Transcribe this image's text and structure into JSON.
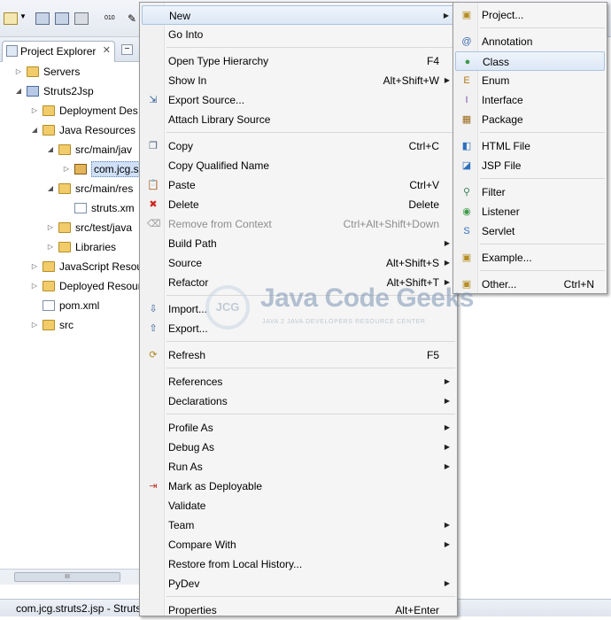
{
  "explorer": {
    "tab_label": "Project Explorer",
    "tree": [
      {
        "label": "Servers",
        "indent": 0,
        "twisty": "▷",
        "icon": "fold"
      },
      {
        "label": "Struts2Jsp",
        "indent": 0,
        "twisty": "◢",
        "icon": "proj"
      },
      {
        "label": "Deployment Des",
        "indent": 1,
        "twisty": "▷",
        "icon": "fold"
      },
      {
        "label": "Java Resources",
        "indent": 1,
        "twisty": "◢",
        "icon": "fold"
      },
      {
        "label": "src/main/jav",
        "indent": 2,
        "twisty": "◢",
        "icon": "fold"
      },
      {
        "label": "com.jcg.s",
        "indent": 3,
        "twisty": "▷",
        "icon": "pkg",
        "selected": true
      },
      {
        "label": "src/main/res",
        "indent": 2,
        "twisty": "◢",
        "icon": "fold"
      },
      {
        "label": "struts.xm",
        "indent": 3,
        "twisty": "",
        "icon": "filex"
      },
      {
        "label": "src/test/java",
        "indent": 2,
        "twisty": "▷",
        "icon": "fold"
      },
      {
        "label": "Libraries",
        "indent": 2,
        "twisty": "▷",
        "icon": "fold"
      },
      {
        "label": "JavaScript Resou",
        "indent": 1,
        "twisty": "▷",
        "icon": "fold"
      },
      {
        "label": "Deployed Resour",
        "indent": 1,
        "twisty": "▷",
        "icon": "fold"
      },
      {
        "label": "pom.xml",
        "indent": 1,
        "twisty": "",
        "icon": "filex"
      },
      {
        "label": "src",
        "indent": 1,
        "twisty": "▷",
        "icon": "fold"
      }
    ]
  },
  "status": {
    "text": "com.jcg.struts2.jsp - Struts"
  },
  "context_menu": {
    "items": [
      {
        "label": "New",
        "shortcut": "",
        "submenu": true,
        "highlighted": true,
        "icon": ""
      },
      {
        "label": "Go Into",
        "shortcut": "",
        "icon": ""
      },
      {
        "separator": true
      },
      {
        "label": "Open Type Hierarchy",
        "shortcut": "F4",
        "icon": ""
      },
      {
        "label": "Show In",
        "shortcut": "Alt+Shift+W",
        "submenu": true,
        "icon": ""
      },
      {
        "label": "Export Source...",
        "shortcut": "",
        "icon": "export-source-icon"
      },
      {
        "label": "Attach Library Source",
        "shortcut": "",
        "icon": ""
      },
      {
        "separator": true
      },
      {
        "label": "Copy",
        "shortcut": "Ctrl+C",
        "icon": "copy-icon"
      },
      {
        "label": "Copy Qualified Name",
        "shortcut": "",
        "icon": ""
      },
      {
        "label": "Paste",
        "shortcut": "Ctrl+V",
        "icon": "paste-icon"
      },
      {
        "label": "Delete",
        "shortcut": "Delete",
        "icon": "delete-icon"
      },
      {
        "label": "Remove from Context",
        "shortcut": "Ctrl+Alt+Shift+Down",
        "disabled": true,
        "icon": "remove-context-icon"
      },
      {
        "label": "Build Path",
        "shortcut": "",
        "submenu": true,
        "icon": ""
      },
      {
        "label": "Source",
        "shortcut": "Alt+Shift+S",
        "submenu": true,
        "icon": ""
      },
      {
        "label": "Refactor",
        "shortcut": "Alt+Shift+T",
        "submenu": true,
        "icon": ""
      },
      {
        "separator": true
      },
      {
        "label": "Import...",
        "shortcut": "",
        "icon": "import-icon"
      },
      {
        "label": "Export...",
        "shortcut": "",
        "icon": "export-icon"
      },
      {
        "separator": true
      },
      {
        "label": "Refresh",
        "shortcut": "F5",
        "icon": "refresh-icon"
      },
      {
        "separator": true
      },
      {
        "label": "References",
        "shortcut": "",
        "submenu": true,
        "icon": ""
      },
      {
        "label": "Declarations",
        "shortcut": "",
        "submenu": true,
        "icon": ""
      },
      {
        "separator": true
      },
      {
        "label": "Profile As",
        "shortcut": "",
        "submenu": true,
        "icon": ""
      },
      {
        "label": "Debug As",
        "shortcut": "",
        "submenu": true,
        "icon": ""
      },
      {
        "label": "Run As",
        "shortcut": "",
        "submenu": true,
        "icon": ""
      },
      {
        "label": "Mark as Deployable",
        "shortcut": "",
        "icon": "deployable-icon"
      },
      {
        "label": "Validate",
        "shortcut": "",
        "icon": ""
      },
      {
        "label": "Team",
        "shortcut": "",
        "submenu": true,
        "icon": ""
      },
      {
        "label": "Compare With",
        "shortcut": "",
        "submenu": true,
        "icon": ""
      },
      {
        "label": "Restore from Local History...",
        "shortcut": "",
        "icon": ""
      },
      {
        "label": "PyDev",
        "shortcut": "",
        "submenu": true,
        "icon": ""
      },
      {
        "separator": true
      },
      {
        "label": "Properties",
        "shortcut": "Alt+Enter",
        "icon": ""
      }
    ]
  },
  "submenu_new": {
    "items": [
      {
        "label": "Project...",
        "shortcut": "",
        "icon": "new-project-icon"
      },
      {
        "separator": true
      },
      {
        "label": "Annotation",
        "shortcut": "",
        "icon": "annotation-icon"
      },
      {
        "label": "Class",
        "shortcut": "",
        "icon": "class-icon",
        "highlighted": true
      },
      {
        "label": "Enum",
        "shortcut": "",
        "icon": "enum-icon"
      },
      {
        "label": "Interface",
        "shortcut": "",
        "icon": "interface-icon"
      },
      {
        "label": "Package",
        "shortcut": "",
        "icon": "package-icon"
      },
      {
        "separator": true
      },
      {
        "label": "HTML File",
        "shortcut": "",
        "icon": "html-file-icon"
      },
      {
        "label": "JSP File",
        "shortcut": "",
        "icon": "jsp-file-icon"
      },
      {
        "separator": true
      },
      {
        "label": "Filter",
        "shortcut": "",
        "icon": "filter-icon"
      },
      {
        "label": "Listener",
        "shortcut": "",
        "icon": "listener-icon"
      },
      {
        "label": "Servlet",
        "shortcut": "",
        "icon": "servlet-icon"
      },
      {
        "separator": true
      },
      {
        "label": "Example...",
        "shortcut": "",
        "icon": "example-icon"
      },
      {
        "separator": true
      },
      {
        "label": "Other...",
        "shortcut": "Ctrl+N",
        "icon": "other-icon"
      }
    ]
  },
  "watermark": {
    "badge": "JCG",
    "title": "Java Code Geeks",
    "subtitle": "JAVA 2 JAVA DEVELOPERS RESOURCE CENTER"
  },
  "colors": {
    "menu_bg": "#f5f5f5",
    "highlight_border": "#aac3e4",
    "selection": "#cfe0f7"
  }
}
